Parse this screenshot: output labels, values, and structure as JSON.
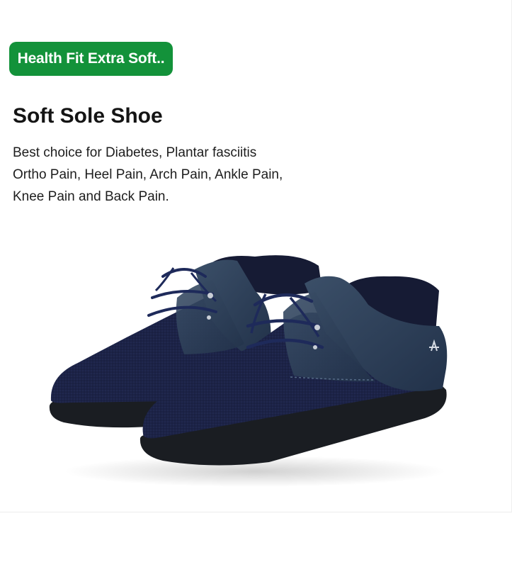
{
  "badge": {
    "label": "Health Fit Extra Soft..",
    "color": "#13923a"
  },
  "product": {
    "title": "Soft Sole Shoe",
    "description_lines": [
      "Best choice for Diabetes, Plantar fasciitis",
      "Ortho Pain, Heel Pain, Arch Pain, Ankle Pain,",
      "Knee Pain and Back Pain."
    ]
  },
  "image": {
    "subject": "pair of navy blue knit lace-up shoes with black soft soles",
    "colors": {
      "mesh": "#1c2347",
      "leather": "#2b3d55",
      "sole": "#1a1d22"
    }
  }
}
